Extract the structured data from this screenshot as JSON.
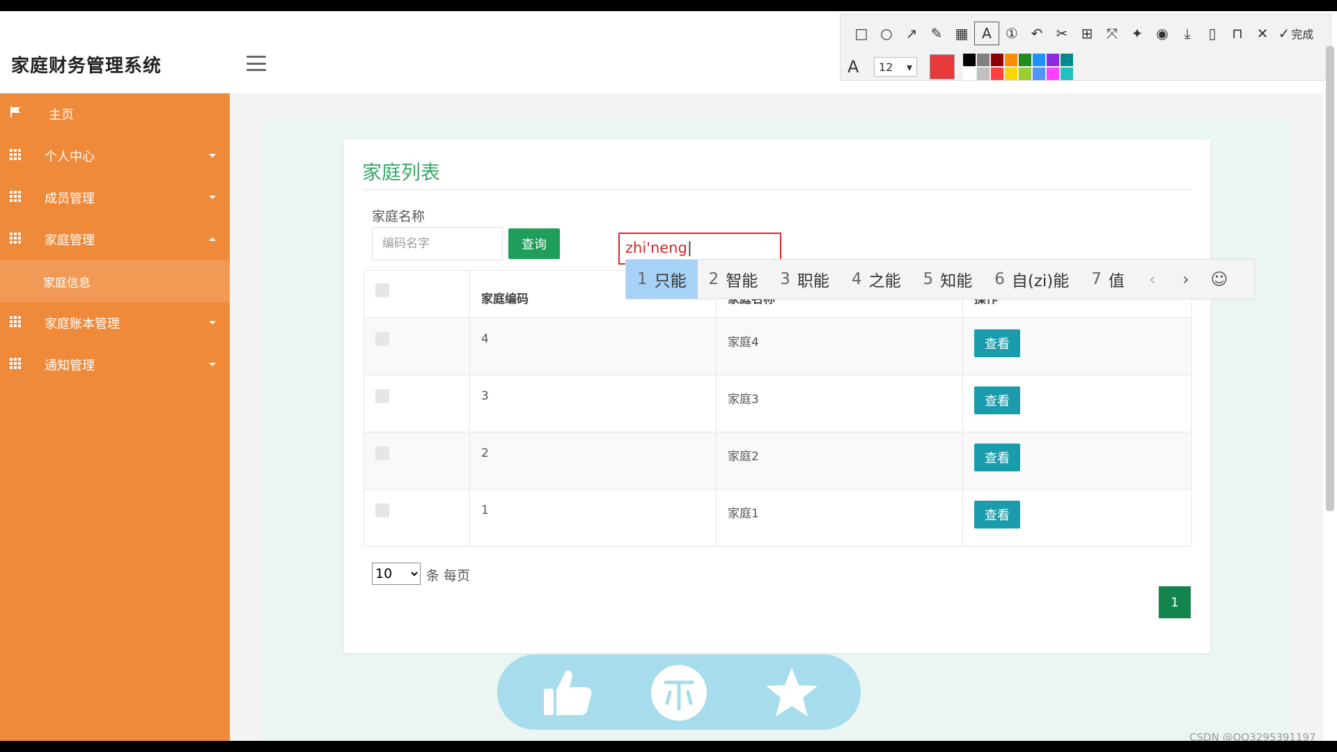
{
  "app": {
    "title": "家庭财务管理系统",
    "avatar_text": "80x80"
  },
  "snap_toolbar": {
    "done_label": "完成",
    "font_size": "12",
    "current_color": "#e83a3a",
    "palette": [
      "#000000",
      "#808080",
      "#8b0000",
      "#ff8c00",
      "#228b22",
      "#1e90ff",
      "#8a2be2",
      "#008b8b",
      "#ffffff",
      "#c0c0c0",
      "#ff4040",
      "#ffd700",
      "#9acd32",
      "#4f94ff",
      "#ff40ff",
      "#20c0c0"
    ]
  },
  "sidebar": {
    "items": [
      {
        "label": "主页"
      },
      {
        "label": "个人中心"
      },
      {
        "label": "成员管理"
      },
      {
        "label": "家庭管理"
      },
      {
        "label": "家庭账本管理"
      },
      {
        "label": "通知管理"
      }
    ],
    "submenu": {
      "label": "家庭信息"
    }
  },
  "card": {
    "title": "家庭列表",
    "search_label": "家庭名称",
    "search_placeholder": "编码名字",
    "query_button": "查询",
    "columns": [
      "",
      "家庭编码",
      "家庭名称",
      "操作"
    ],
    "rows": [
      {
        "code": "4",
        "name": "家庭4",
        "action": "查看"
      },
      {
        "code": "3",
        "name": "家庭3",
        "action": "查看"
      },
      {
        "code": "2",
        "name": "家庭2",
        "action": "查看"
      },
      {
        "code": "1",
        "name": "家庭1",
        "action": "查看"
      }
    ],
    "page_size": "10",
    "page_size_label": "条 每页",
    "current_page": "1"
  },
  "ime": {
    "composition": "zhi'neng",
    "candidates": [
      {
        "num": "1",
        "text": "只能"
      },
      {
        "num": "2",
        "text": "智能"
      },
      {
        "num": "3",
        "text": "职能"
      },
      {
        "num": "4",
        "text": "之能"
      },
      {
        "num": "5",
        "text": "知能"
      },
      {
        "num": "6",
        "text": "自(zi)能"
      },
      {
        "num": "7",
        "text": "值"
      }
    ]
  },
  "watermark": "CSDN @QQ3295391197"
}
